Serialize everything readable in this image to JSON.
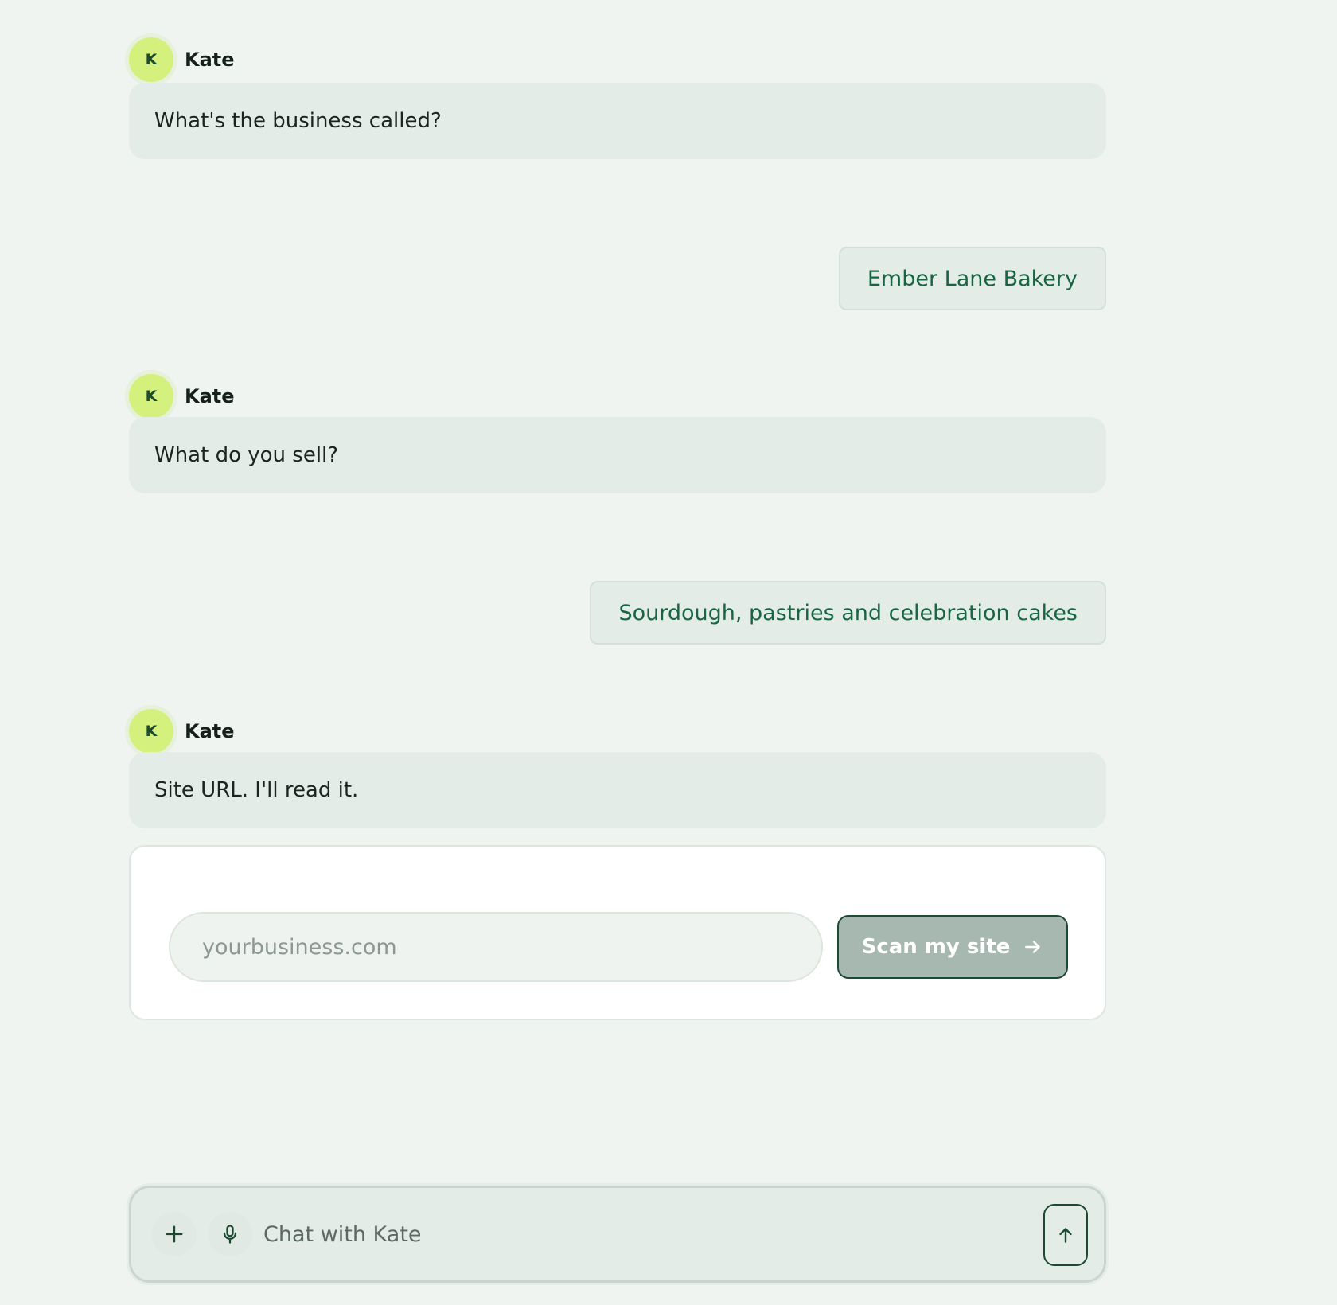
{
  "agent": {
    "name": "Kate",
    "initial": "K"
  },
  "messages": [
    {
      "role": "agent",
      "text": "What's the business called?"
    },
    {
      "role": "user",
      "text": "Ember Lane Bakery"
    },
    {
      "role": "agent",
      "text": "What do you sell?"
    },
    {
      "role": "user",
      "text": "Sourdough, pastries and celebration cakes"
    },
    {
      "role": "agent",
      "text": "Site URL. I'll read it."
    }
  ],
  "url_card": {
    "placeholder": "yourbusiness.com",
    "value": "",
    "button_label": "Scan my site",
    "button_icon": "arrow-right-icon"
  },
  "composer": {
    "placeholder": "Chat with Kate",
    "value": "",
    "icons": [
      "plus-icon",
      "microphone-icon",
      "arrow-up-icon"
    ]
  },
  "colors": {
    "background": "#eff4f0",
    "avatar": "#d3f17c",
    "agent_bubble": "#e4ece7",
    "user_text": "#186544",
    "scan_button": "#a7b8b0",
    "accent_dark": "#1d4a33"
  }
}
